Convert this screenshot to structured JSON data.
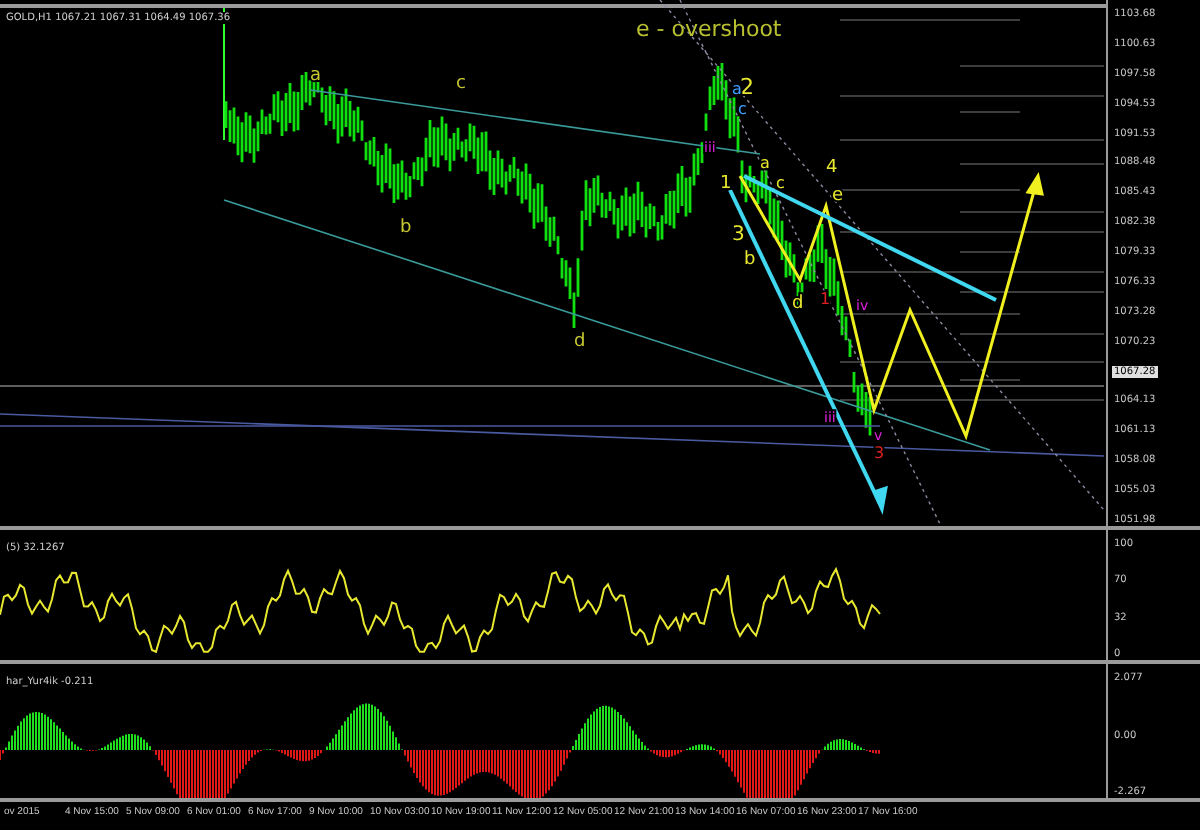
{
  "chart": {
    "title": "GOLD,H1 1067.21 1067.31 1064.49 1067.36",
    "annotation": "e - overshoot",
    "wave_labels": [
      {
        "text": "a",
        "color": "#c8c832"
      },
      {
        "text": "c",
        "color": "#c8c832"
      },
      {
        "text": "b",
        "color": "#c8c832"
      },
      {
        "text": "d",
        "color": "#c8c832"
      },
      {
        "text": "2",
        "color": "#e8e830"
      },
      {
        "text": "4",
        "color": "#e8e830"
      },
      {
        "text": "1",
        "color": "#e8e830"
      },
      {
        "text": "3",
        "color": "#e8e830"
      },
      {
        "text": "a",
        "color": "#e8e830"
      },
      {
        "text": "c",
        "color": "#e8e830"
      },
      {
        "text": "b",
        "color": "#e8e830"
      },
      {
        "text": "e",
        "color": "#e8e830"
      },
      {
        "text": "d",
        "color": "#e8e830"
      },
      {
        "text": "a",
        "color": "#40a0ff"
      },
      {
        "text": "c",
        "color": "#40a0ff"
      },
      {
        "text": "iii",
        "color": "#e020e0"
      },
      {
        "text": "iv",
        "color": "#e020e0"
      },
      {
        "text": "v",
        "color": "#e020e0"
      },
      {
        "text": "iii",
        "color": "#e020e0"
      },
      {
        "text": "1",
        "color": "#e02020"
      },
      {
        "text": "3",
        "color": "#e02020"
      }
    ],
    "price_axis": [
      {
        "label": "1103.68",
        "highlighted": false
      },
      {
        "label": "1100.63",
        "highlighted": false
      },
      {
        "label": "1097.58",
        "highlighted": false
      },
      {
        "label": "1094.53",
        "highlighted": false
      },
      {
        "label": "1091.53",
        "highlighted": false
      },
      {
        "label": "1088.48",
        "highlighted": false
      },
      {
        "label": "1085.43",
        "highlighted": false
      },
      {
        "label": "1082.38",
        "highlighted": false
      },
      {
        "label": "1079.33",
        "highlighted": false
      },
      {
        "label": "1076.33",
        "highlighted": false
      },
      {
        "label": "1073.28",
        "highlighted": false
      },
      {
        "label": "1070.23",
        "highlighted": false
      },
      {
        "label": "1067.28",
        "highlighted": true
      },
      {
        "label": "1064.13",
        "highlighted": false
      },
      {
        "label": "1061.13",
        "highlighted": false
      },
      {
        "label": "1058.08",
        "highlighted": false
      },
      {
        "label": "1055.03",
        "highlighted": false
      },
      {
        "label": "1051.98",
        "highlighted": false
      }
    ]
  },
  "rsi": {
    "label": "(5) 32.1267",
    "axis": [
      "100",
      "70",
      "32",
      "0"
    ]
  },
  "histogram": {
    "label": "har_Yur4ik -0.211",
    "axis": [
      "2.077",
      "0.00",
      "-2.267"
    ]
  },
  "time_axis": [
    "ov 2015",
    "4 Nov 15:00",
    "5 Nov 09:00",
    "6 Nov 01:00",
    "6 Nov 17:00",
    "9 Nov 10:00",
    "10 Nov 03:00",
    "10 Nov 19:00",
    "11 Nov 12:00",
    "12 Nov 05:00",
    "12 Nov 21:00",
    "13 Nov 14:00",
    "16 Nov 07:00",
    "16 Nov 23:00",
    "17 Nov 16:00"
  ]
}
